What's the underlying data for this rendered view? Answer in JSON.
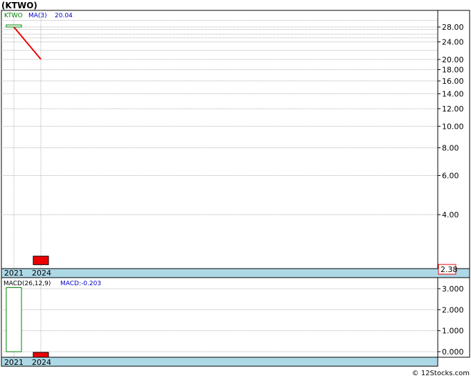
{
  "chart_data": [
    {
      "type": "candlestick",
      "title": "(KTWO)",
      "symbol": "KTWO",
      "y_scale": "log",
      "y_ticks": [
        28.0,
        24.0,
        20.0,
        18.0,
        16.0,
        14.0,
        12.0,
        10.0,
        8.0,
        6.0,
        4.0
      ],
      "ylim": [
        2.3,
        33
      ],
      "x_labels": [
        "2021",
        "2024"
      ],
      "candles": [
        {
          "x": "2021",
          "open": 28.6,
          "high": 28.9,
          "low": 28.3,
          "close": 28.4,
          "color": "green"
        },
        {
          "x": "2024",
          "open": 2.6,
          "high": 2.6,
          "low": 2.38,
          "close": 2.38,
          "color": "red"
        }
      ],
      "ma": {
        "label": "MA(3)",
        "value_label": "20.04",
        "points": [
          {
            "x": "2021",
            "y": 28.0
          },
          {
            "x": "2024",
            "y": 20.04
          }
        ]
      },
      "last_price": "2.38",
      "legend_labels": {
        "symbol": "KTWO",
        "ma": "MA(3)",
        "ma_value": "20.04"
      }
    },
    {
      "type": "macd",
      "label": "MACD(26,12,9)",
      "value_label": "MACD:-0.203",
      "y_ticks": [
        3.0,
        2.0,
        1.0,
        0.0
      ],
      "ylim": [
        -0.25,
        3.4
      ],
      "x_labels": [
        "2021",
        "2024"
      ],
      "bars": [
        {
          "x": "2021",
          "value": 3.05,
          "color": "green"
        },
        {
          "x": "2024",
          "value": -0.203,
          "color": "red"
        }
      ]
    }
  ],
  "footer": {
    "credit": "© 12Stocks.com"
  },
  "colors": {
    "up": "#008000",
    "down": "#ee0000",
    "ma": "#ee0000",
    "axis_band": "#add8e6",
    "grid": "#b0b0b0",
    "legend_blue": "#0000cc"
  }
}
